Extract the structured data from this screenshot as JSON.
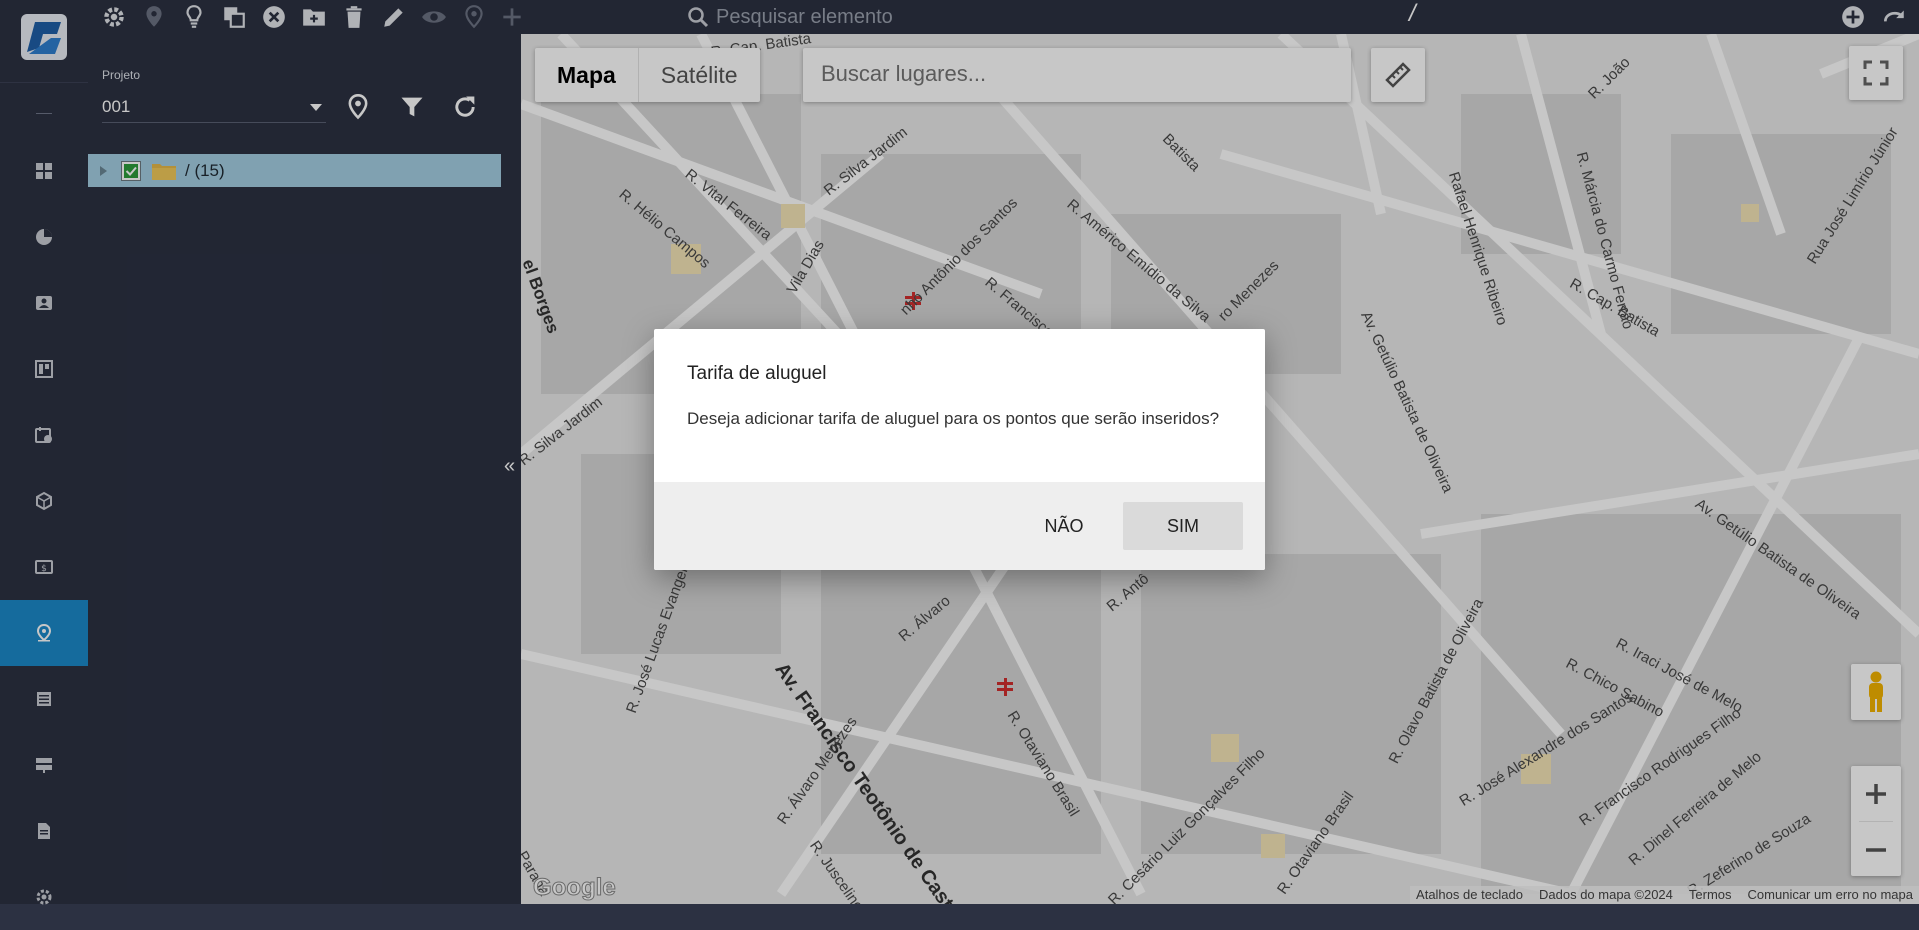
{
  "toolbar": {
    "search_placeholder": "Pesquisar elemento",
    "path": "/"
  },
  "project": {
    "label": "Projeto",
    "selected": "001",
    "tree_root_label": "/ (15)"
  },
  "map": {
    "type_map": "Mapa",
    "type_satellite": "Satélite",
    "search_placeholder": "Buscar lugares...",
    "google": "Google",
    "attribution": [
      "Atalhos de teclado",
      "Dados do mapa ©2024",
      "Termos",
      "Comunicar um erro no mapa"
    ],
    "streets": [
      "R. Cap. Batista",
      "R. Vital Ferreira",
      "R. Silva Jardim",
      "R. Hélio Campos",
      "R. Américo Emídio da Silva",
      "R. Francisco",
      "Vila Dias",
      "nho Antônio dos Santos",
      "R. Cap. Batista",
      "Rafael Henrique Ribeiro",
      "R. Márcia do Carmo Ferrão",
      "Rua José Limírio Júnior",
      "R. João",
      "Av. Getúlio Batista de Oliveira",
      "Av. Getúlio Batista de Oliveira",
      "Av. Francisco Teotônio de Castro",
      "R. José Lucas Evangelista",
      "R. Otaviano Brasil",
      "R. Álvaro Menezes",
      "R. Juscelino de",
      "R. Cesário Luiz Gonçalves Filho",
      "R. Otaviano Brasil",
      "R. Olavo Batista de Oliveira",
      "R. José Alexandre dos Santos",
      "R. Chico Sabino",
      "R. Iraci José de Melo",
      "R. Francisco Rodrigues Filho",
      "R. Dinel Ferreira de Melo",
      "R. Zeferino de Souza",
      "R. Silva Jardim",
      "el Borges",
      "Paraná",
      "R. Álvaro",
      "R. Antô",
      "Batista",
      "ro Menezes"
    ]
  },
  "dialog": {
    "title": "Tarifa de aluguel",
    "message": "Deseja adicionar tarifa de aluguel para os pontos que serão inseridos?",
    "no_label": "NÃO",
    "yes_label": "SIM"
  }
}
